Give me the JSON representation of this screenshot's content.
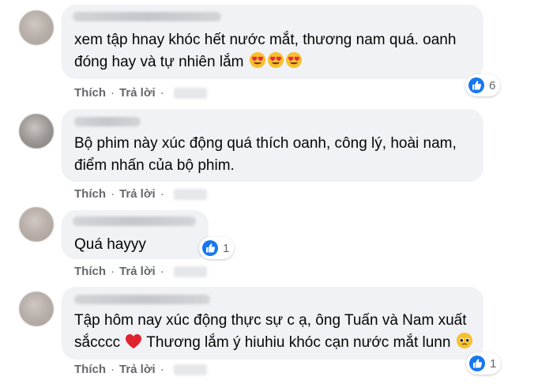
{
  "comments": [
    {
      "lines": [
        "xem tập hnay khóc hết nước mắt, thương nam quá. oanh",
        "đóng hay và tự nhiên lắm"
      ],
      "emojis": [
        "heart-eyes-emoji",
        "heart-eyes-emoji",
        "heart-eyes-emoji"
      ],
      "reaction_count": "6",
      "actions": {
        "like": "Thích",
        "reply": "Trả lời"
      }
    },
    {
      "lines": [
        "Bộ phim này xúc động quá thích oanh, công lý, hoài nam,",
        "điểm nhấn của bộ phim."
      ],
      "actions": {
        "like": "Thích",
        "reply": "Trả lời"
      }
    },
    {
      "lines": [
        "Quá hayyy"
      ],
      "reaction_count": "1",
      "actions": {
        "like": "Thích",
        "reply": "Trả lời"
      }
    },
    {
      "lines": [
        "Tập hôm nay xúc động thực sự c ạ, ông Tuấn và Nam xuất",
        "sắcccc",
        "Thương lắm ý hiuhiu khóc cạn nước mắt lunn"
      ],
      "emojis": [
        "red-heart-emoji",
        "pleading-face-emoji"
      ],
      "reaction_count": "1",
      "actions": {
        "like": "Thích",
        "reply": "Trả lời"
      }
    }
  ],
  "colors": {
    "bubble": "#f0f2f5",
    "action_text": "#65676b",
    "like_blue": "#1877f2"
  }
}
